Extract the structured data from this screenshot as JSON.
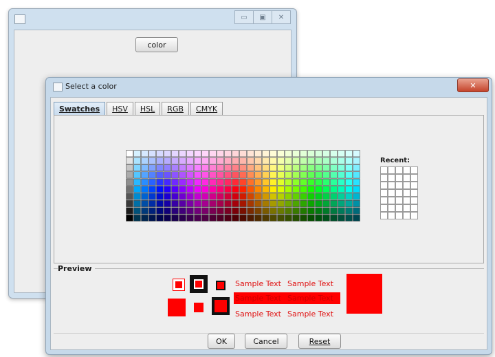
{
  "back_window": {
    "title": "",
    "controls": {
      "minimize": "▭",
      "maximize": "▣",
      "close": "✕"
    },
    "color_button_label": "color"
  },
  "dialog": {
    "title": "Select a color",
    "close_label": "✕",
    "tabs": [
      {
        "label": "Swatches",
        "active": true
      },
      {
        "label": "HSV",
        "active": false
      },
      {
        "label": "HSL",
        "active": false
      },
      {
        "label": "RGB",
        "active": false
      },
      {
        "label": "CMYK",
        "active": false
      }
    ],
    "recent_label": "Recent:",
    "preview_label": "Preview",
    "sample_text": "Sample Text",
    "selected_color": "#ff0000",
    "buttons": {
      "ok": "OK",
      "cancel": "Cancel",
      "reset": "Reset"
    }
  }
}
